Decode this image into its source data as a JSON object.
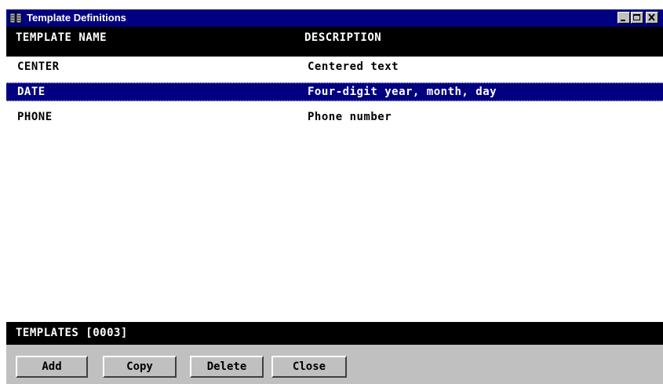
{
  "window": {
    "title": "Template Definitions",
    "icon": "book-icon",
    "controls": [
      "minimize-icon",
      "maximize-icon",
      "close-icon"
    ]
  },
  "table": {
    "columns": [
      "TEMPLATE NAME",
      "DESCRIPTION"
    ],
    "rows": [
      {
        "name": "CENTER",
        "description": "Centered text"
      },
      {
        "name": "DATE",
        "description": "Four-digit year, month, day"
      },
      {
        "name": "PHONE",
        "description": "Phone number"
      }
    ],
    "selected_index": 1
  },
  "status": {
    "label": "TEMPLATES [0003]"
  },
  "buttons": {
    "add": "Add",
    "copy": "Copy",
    "delete": "Delete",
    "close": "Close"
  },
  "colors": {
    "title_bar": "#000080",
    "selection": "#000080",
    "header_bg": "#000000",
    "face": "#c0c0c0"
  }
}
